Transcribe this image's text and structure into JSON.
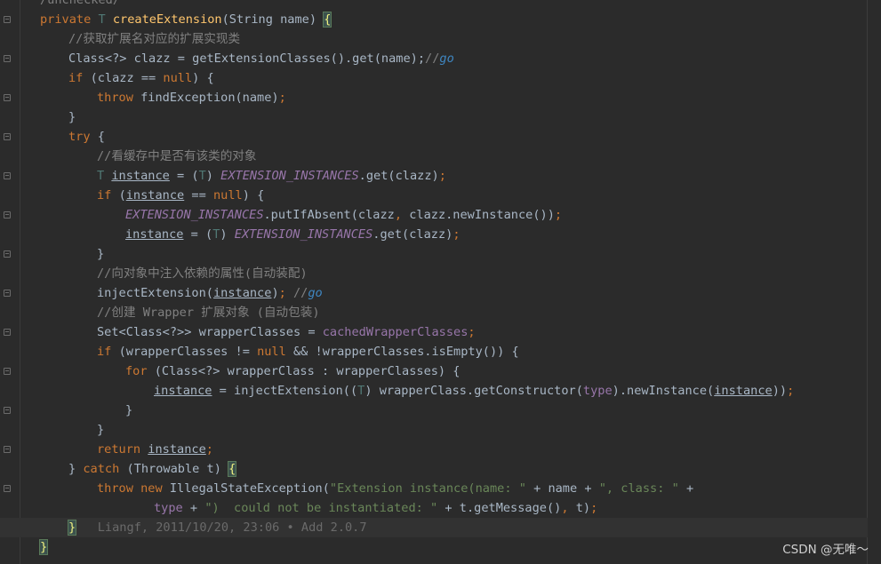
{
  "editor": {
    "lines": [
      {
        "indent": 1,
        "tokens": [
          {
            "c": "cm",
            "t": "/unchecked/"
          }
        ]
      },
      {
        "indent": 1,
        "tokens": [
          {
            "c": "kw",
            "t": "private "
          },
          {
            "c": "ty",
            "t": "T "
          },
          {
            "c": "fn",
            "t": "createExtension"
          },
          {
            "c": "pl",
            "t": "(String name) "
          },
          {
            "c": "br-hl",
            "t": "{"
          }
        ]
      },
      {
        "indent": 2,
        "tokens": [
          {
            "c": "cm",
            "t": "//获取扩展名对应的扩展实现类"
          }
        ]
      },
      {
        "indent": 2,
        "tokens": [
          {
            "c": "pl",
            "t": "Class<?> clazz = getExtensionClasses().get(name);"
          },
          {
            "c": "cm",
            "t": "//"
          },
          {
            "c": "todo",
            "t": "go"
          }
        ]
      },
      {
        "indent": 2,
        "tokens": [
          {
            "c": "kw",
            "t": "if "
          },
          {
            "c": "pl",
            "t": "(clazz == "
          },
          {
            "c": "kw",
            "t": "null"
          },
          {
            "c": "pl",
            "t": ") {"
          }
        ]
      },
      {
        "indent": 3,
        "tokens": [
          {
            "c": "kw",
            "t": "throw "
          },
          {
            "c": "pl",
            "t": "findException(name)"
          },
          {
            "c": "kw",
            "t": ";"
          }
        ]
      },
      {
        "indent": 2,
        "tokens": [
          {
            "c": "pl",
            "t": "}"
          }
        ]
      },
      {
        "indent": 2,
        "tokens": [
          {
            "c": "kw",
            "t": "try "
          },
          {
            "c": "pl",
            "t": "{"
          }
        ]
      },
      {
        "indent": 3,
        "tokens": [
          {
            "c": "cm",
            "t": "//看缓存中是否有该类的对象"
          }
        ]
      },
      {
        "indent": 3,
        "tokens": [
          {
            "c": "ty",
            "t": "T "
          },
          {
            "c": "pl u",
            "t": "instance"
          },
          {
            "c": "pl",
            "t": " = ("
          },
          {
            "c": "ty",
            "t": "T"
          },
          {
            "c": "pl",
            "t": ") "
          },
          {
            "c": "sf",
            "t": "EXTENSION_INSTANCES"
          },
          {
            "c": "pl",
            "t": ".get(clazz)"
          },
          {
            "c": "kw",
            "t": ";"
          }
        ]
      },
      {
        "indent": 3,
        "tokens": [
          {
            "c": "kw",
            "t": "if "
          },
          {
            "c": "pl",
            "t": "("
          },
          {
            "c": "pl u",
            "t": "instance"
          },
          {
            "c": "pl",
            "t": " == "
          },
          {
            "c": "kw",
            "t": "null"
          },
          {
            "c": "pl",
            "t": ") {"
          }
        ]
      },
      {
        "indent": 4,
        "tokens": [
          {
            "c": "sf",
            "t": "EXTENSION_INSTANCES"
          },
          {
            "c": "pl",
            "t": ".putIfAbsent(clazz"
          },
          {
            "c": "kw",
            "t": ", "
          },
          {
            "c": "pl",
            "t": "clazz.newInstance())"
          },
          {
            "c": "kw",
            "t": ";"
          }
        ]
      },
      {
        "indent": 4,
        "tokens": [
          {
            "c": "pl u",
            "t": "instance"
          },
          {
            "c": "pl",
            "t": " = ("
          },
          {
            "c": "ty",
            "t": "T"
          },
          {
            "c": "pl",
            "t": ") "
          },
          {
            "c": "sf",
            "t": "EXTENSION_INSTANCES"
          },
          {
            "c": "pl",
            "t": ".get(clazz)"
          },
          {
            "c": "kw",
            "t": ";"
          }
        ]
      },
      {
        "indent": 3,
        "tokens": [
          {
            "c": "pl",
            "t": "}"
          }
        ]
      },
      {
        "indent": 3,
        "tokens": [
          {
            "c": "cm",
            "t": "//向对象中注入依赖的属性(自动装配)"
          }
        ]
      },
      {
        "indent": 3,
        "tokens": [
          {
            "c": "pl",
            "t": "injectExtension("
          },
          {
            "c": "pl u",
            "t": "instance"
          },
          {
            "c": "pl",
            "t": ")"
          },
          {
            "c": "kw",
            "t": "; "
          },
          {
            "c": "cm",
            "t": "//"
          },
          {
            "c": "todo",
            "t": "go"
          }
        ]
      },
      {
        "indent": 3,
        "tokens": [
          {
            "c": "cm",
            "t": "//创建 Wrapper 扩展对象 (自动包装)"
          }
        ]
      },
      {
        "indent": 3,
        "tokens": [
          {
            "c": "pl",
            "t": "Set<Class<?>> wrapperClasses = "
          },
          {
            "c": "fd",
            "t": "cachedWrapperClasses"
          },
          {
            "c": "kw",
            "t": ";"
          }
        ]
      },
      {
        "indent": 3,
        "tokens": [
          {
            "c": "kw",
            "t": "if "
          },
          {
            "c": "pl",
            "t": "(wrapperClasses != "
          },
          {
            "c": "kw",
            "t": "null "
          },
          {
            "c": "pl",
            "t": "&& !wrapperClasses.isEmpty()) {"
          }
        ]
      },
      {
        "indent": 4,
        "tokens": [
          {
            "c": "kw",
            "t": "for "
          },
          {
            "c": "pl",
            "t": "(Class<?> wrapperClass : wrapperClasses) {"
          }
        ]
      },
      {
        "indent": 5,
        "tokens": [
          {
            "c": "pl u",
            "t": "instance"
          },
          {
            "c": "pl",
            "t": " = injectExtension(("
          },
          {
            "c": "ty",
            "t": "T"
          },
          {
            "c": "pl",
            "t": ") wrapperClass.getConstructor("
          },
          {
            "c": "fd",
            "t": "type"
          },
          {
            "c": "pl",
            "t": ").newInstance("
          },
          {
            "c": "pl u",
            "t": "instance"
          },
          {
            "c": "pl",
            "t": "))"
          },
          {
            "c": "kw",
            "t": ";"
          }
        ]
      },
      {
        "indent": 4,
        "tokens": [
          {
            "c": "pl",
            "t": "}"
          }
        ]
      },
      {
        "indent": 3,
        "tokens": [
          {
            "c": "pl",
            "t": "}"
          }
        ]
      },
      {
        "indent": 3,
        "tokens": [
          {
            "c": "kw",
            "t": "return "
          },
          {
            "c": "pl u",
            "t": "instance"
          },
          {
            "c": "kw",
            "t": ";"
          }
        ]
      },
      {
        "indent": 2,
        "tokens": [
          {
            "c": "pl",
            "t": "} "
          },
          {
            "c": "kw",
            "t": "catch "
          },
          {
            "c": "pl",
            "t": "(Throwable t) "
          },
          {
            "c": "br-hl",
            "t": "{"
          }
        ]
      },
      {
        "indent": 3,
        "tokens": [
          {
            "c": "kw",
            "t": "throw new "
          },
          {
            "c": "pl",
            "t": "IllegalStateException("
          },
          {
            "c": "st",
            "t": "\"Extension instance(name: \""
          },
          {
            "c": "pl",
            "t": " + name + "
          },
          {
            "c": "st",
            "t": "\", class: \""
          },
          {
            "c": "pl",
            "t": " +"
          }
        ]
      },
      {
        "indent": 5,
        "tokens": [
          {
            "c": "fd",
            "t": "type"
          },
          {
            "c": "pl",
            "t": " + "
          },
          {
            "c": "st",
            "t": "\")  could not be instantiated: \""
          },
          {
            "c": "pl",
            "t": " + t.getMessage()"
          },
          {
            "c": "kw",
            "t": ", "
          },
          {
            "c": "pl",
            "t": "t)"
          },
          {
            "c": "kw",
            "t": ";"
          }
        ]
      },
      {
        "indent": 2,
        "current": true,
        "tokens": [
          {
            "c": "br-hl",
            "t": "}"
          },
          {
            "c": "hint",
            "t": "   Liangf, 2011/10/20, 23:06 • Add 2.0.7"
          }
        ]
      },
      {
        "indent": 1,
        "tokens": [
          {
            "c": "br-hl",
            "t": "}"
          }
        ]
      }
    ]
  },
  "watermark": "CSDN @无唯～"
}
